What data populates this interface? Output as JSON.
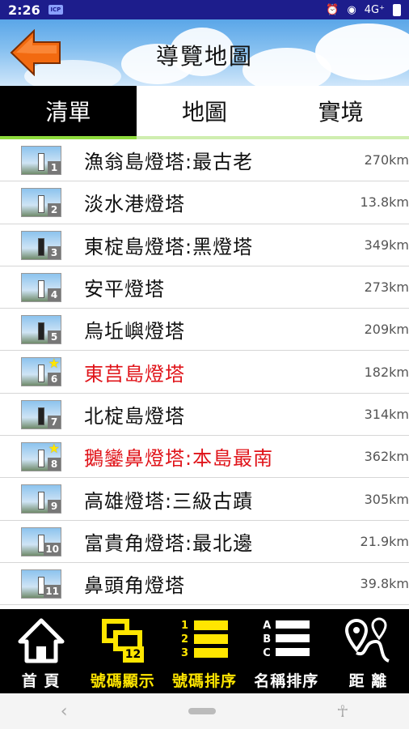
{
  "status": {
    "time": "2:26",
    "network": "4G⁺",
    "small_icon": "ICP"
  },
  "header": {
    "title": "導覽地圖",
    "back_icon": "arrow-left-icon"
  },
  "tabs": [
    {
      "label": "清單",
      "active": true
    },
    {
      "label": "地圖",
      "active": false
    },
    {
      "label": "實境",
      "active": false
    }
  ],
  "list": [
    {
      "num": "1",
      "name": "漁翁島燈塔:最古老",
      "dist": "270km",
      "highlight": false,
      "star": false
    },
    {
      "num": "2",
      "name": "淡水港燈塔",
      "dist": "13.8km",
      "highlight": false,
      "star": false
    },
    {
      "num": "3",
      "name": "東椗島燈塔:黑燈塔",
      "dist": "349km",
      "highlight": false,
      "star": false
    },
    {
      "num": "4",
      "name": "安平燈塔",
      "dist": "273km",
      "highlight": false,
      "star": false
    },
    {
      "num": "5",
      "name": "烏坵嶼燈塔",
      "dist": "209km",
      "highlight": false,
      "star": false
    },
    {
      "num": "6",
      "name": "東莒島燈塔",
      "dist": "182km",
      "highlight": true,
      "star": true
    },
    {
      "num": "7",
      "name": "北椗島燈塔",
      "dist": "314km",
      "highlight": false,
      "star": false
    },
    {
      "num": "8",
      "name": "鵝鑾鼻燈塔:本島最南",
      "dist": "362km",
      "highlight": true,
      "star": true
    },
    {
      "num": "9",
      "name": "高雄燈塔:三級古蹟",
      "dist": "305km",
      "highlight": false,
      "star": false
    },
    {
      "num": "10",
      "name": "富貴角燈塔:最北邊",
      "dist": "21.9km",
      "highlight": false,
      "star": false
    },
    {
      "num": "11",
      "name": "鼻頭角燈塔",
      "dist": "39.8km",
      "highlight": false,
      "star": false
    }
  ],
  "toolbar": [
    {
      "label": "首 頁",
      "icon": "home-icon",
      "active": false
    },
    {
      "label": "號碼顯示",
      "icon": "number-display-icon",
      "active": true,
      "badge": "12"
    },
    {
      "label": "號碼排序",
      "icon": "number-sort-icon",
      "active": true,
      "digits": [
        "1",
        "2",
        "3"
      ]
    },
    {
      "label": "名稱排序",
      "icon": "name-sort-icon",
      "active": false,
      "letters": [
        "A",
        "B",
        "C"
      ]
    },
    {
      "label": "距 離",
      "icon": "distance-route-icon",
      "active": false
    }
  ],
  "colors": {
    "highlight": "#e0141a",
    "accent_yellow": "#ffe600",
    "tab_underline": "#8edb3c",
    "status_bar": "#1d1d8c"
  }
}
